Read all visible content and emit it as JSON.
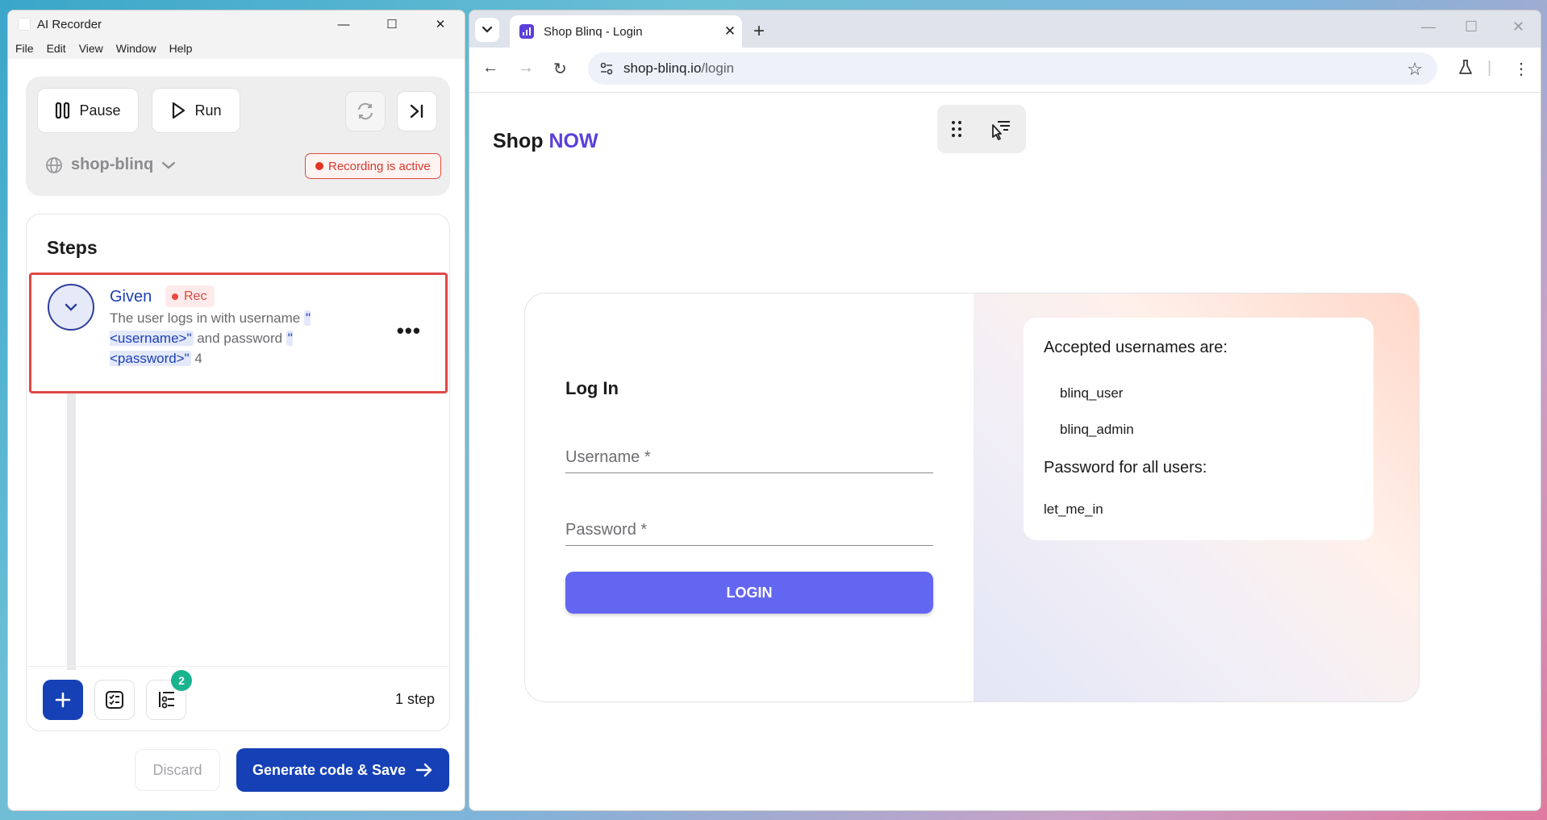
{
  "recorder": {
    "window_title": "AI Recorder",
    "menu": [
      "File",
      "Edit",
      "View",
      "Window",
      "Help"
    ],
    "pause_label": "Pause",
    "run_label": "Run",
    "project": "shop-blinq",
    "recording_status": "Recording is active",
    "steps_title": "Steps",
    "step": {
      "keyword": "Given",
      "rec_label": "Rec",
      "text_1": "The user logs in with username ",
      "param_1": "\"<username>\"",
      "text_2": " and password ",
      "param_2": "\"<password>\"",
      "text_3": " 4"
    },
    "step_count": "1 step",
    "badge_count": "2",
    "discard_label": "Discard",
    "generate_label": "Generate code & Save"
  },
  "browser": {
    "tab_title": "Shop Blinq - Login",
    "url_host": "shop-blinq.io",
    "url_path": "/login"
  },
  "page": {
    "brand_main": "Shop",
    "brand_accent": "NOW",
    "login_title": "Log In",
    "username_placeholder": "Username *",
    "password_placeholder": "Password *",
    "login_button": "LOGIN",
    "info": {
      "usernames_heading": "Accepted usernames are:",
      "usernames": [
        "blinq_user",
        "blinq_admin"
      ],
      "password_heading": "Password for all users:",
      "password": "let_me_in"
    }
  },
  "colors": {
    "accent_blue": "#1640b6",
    "brand_purple": "#5b3fd9",
    "login_button": "#6366f1",
    "recording_red": "#e04848",
    "badge_green": "#19b48e"
  }
}
